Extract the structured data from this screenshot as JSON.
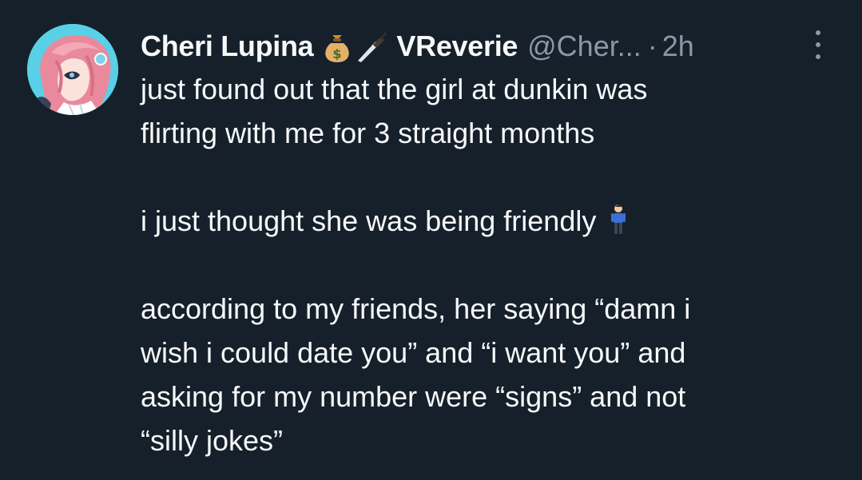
{
  "tweet": {
    "author": {
      "display_name": "Cheri Lupina",
      "name_emojis": [
        "money-bag-icon",
        "dagger-icon"
      ],
      "display_name_suffix": "VReverie",
      "handle": "@Cher...",
      "separator": "·",
      "time": "2h",
      "avatar": "avatar-anime-girl-pink-hair"
    },
    "more_icon": "three-dots-vertical-icon",
    "text": {
      "line1": "just found out that the girl at dunkin was",
      "line2": "flirting with me for 3 straight months",
      "line3": "i just thought she was being friendly",
      "line3_emoji": "person-standing-icon",
      "line4": "according to my friends, her saying “damn i",
      "line5": "wish i could date you” and “i want you” and",
      "line6": "asking for my number were “signs” and not",
      "line7": "“silly jokes”"
    }
  },
  "colors": {
    "background": "#15202b",
    "text_primary": "#f7f9f9",
    "text_secondary": "#8b98a5"
  }
}
